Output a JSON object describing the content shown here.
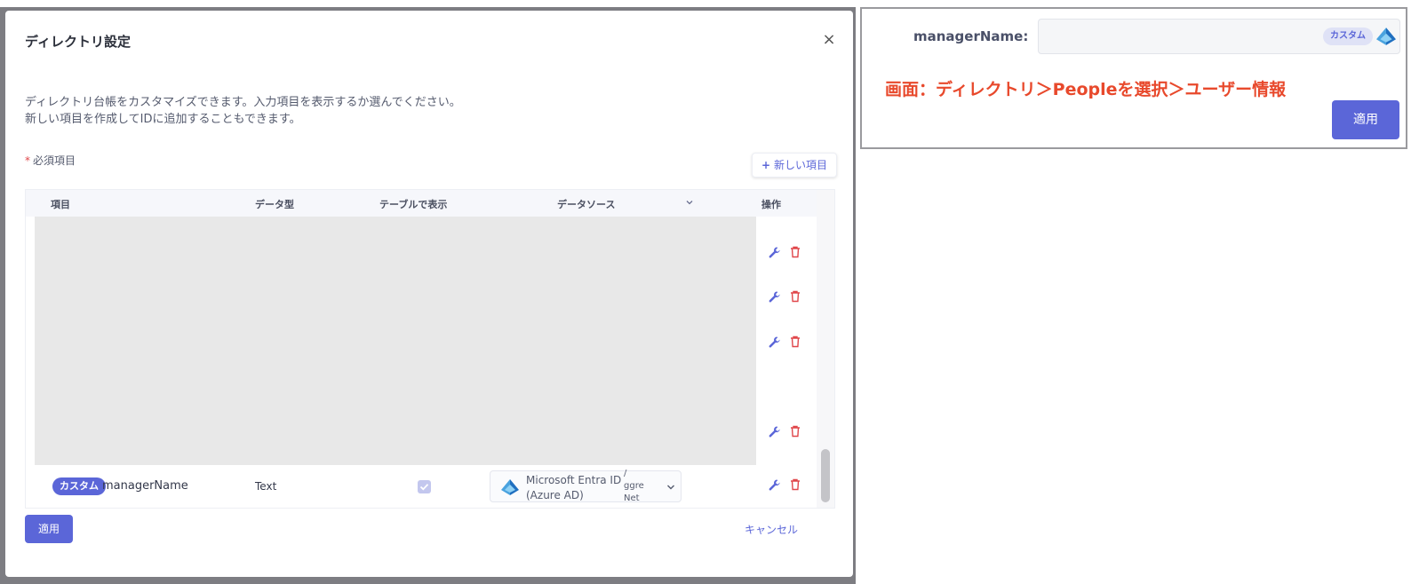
{
  "modal": {
    "title": "ディレクトリ設定",
    "close_label": "×",
    "description_line1": "ディレクトリ台帳をカスタマイズできます。入力項目を表示するか選んでください。",
    "description_line2": "新しい項目を作成してIDに追加することもできます。",
    "required_star": "*",
    "required_label": "必須項目",
    "new_item_label": "新しい項目",
    "apply_label": "適用",
    "cancel_label": "キャンセル"
  },
  "table": {
    "columns": [
      "項目",
      "データ型",
      "テーブルで表示",
      "データソース",
      "操作"
    ],
    "row": {
      "badge": "カスタム",
      "name": "managerName",
      "type": "Text",
      "show_in_table": true,
      "data_source_line1": "Microsoft Entra ID",
      "data_source_line2": "(Azure AD)",
      "data_source_extra1": "/",
      "data_source_extra2": "ggre",
      "data_source_extra3": "Net"
    }
  },
  "panel": {
    "label": "managerName:",
    "badge": "カスタム",
    "note": "画面：ディレクトリ＞Peopleを選択＞ユーザー情報",
    "apply_label": "適用"
  },
  "colors": {
    "accent": "#5b66d8",
    "danger": "#e0464a",
    "note": "#e8492c"
  }
}
